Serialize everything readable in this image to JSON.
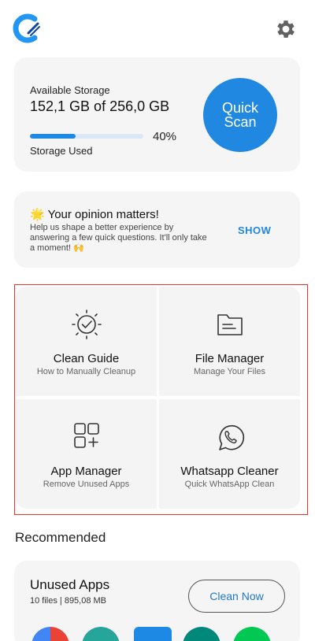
{
  "header": {
    "logo_icon": "app-logo-icon",
    "settings_icon": "gear-icon"
  },
  "storage": {
    "label": "Available Storage",
    "amount": "152,1 GB of 256,0 GB",
    "percent_text": "40%",
    "percent_value": 0.4,
    "used_label": "Storage Used",
    "scan_label_line1": "Quick",
    "scan_label_line2": "Scan"
  },
  "opinion": {
    "title": "🌟 Your opinion matters!",
    "description": "Help us shape a better experience by answering a few quick questions. It'll only take a moment! 🙌",
    "action": "SHOW"
  },
  "tools": [
    {
      "name": "Clean Guide",
      "subtitle": "How to Manually Cleanup",
      "icon": "sparkle-check-icon"
    },
    {
      "name": "File Manager",
      "subtitle": "Manage Your Files",
      "icon": "folder-icon"
    },
    {
      "name": "App Manager",
      "subtitle": "Remove Unused Apps",
      "icon": "apps-grid-icon"
    },
    {
      "name": "Whatsapp Cleaner",
      "subtitle": "Quick WhatsApp Clean",
      "icon": "whatsapp-icon"
    }
  ],
  "recommended": {
    "heading": "Recommended",
    "unused_title": "Unused Apps",
    "unused_subtitle": "10 files | 895,08 MB",
    "clean_label": "Clean Now"
  },
  "colors": {
    "accent": "#2088e0",
    "highlight": "#e3342f"
  }
}
